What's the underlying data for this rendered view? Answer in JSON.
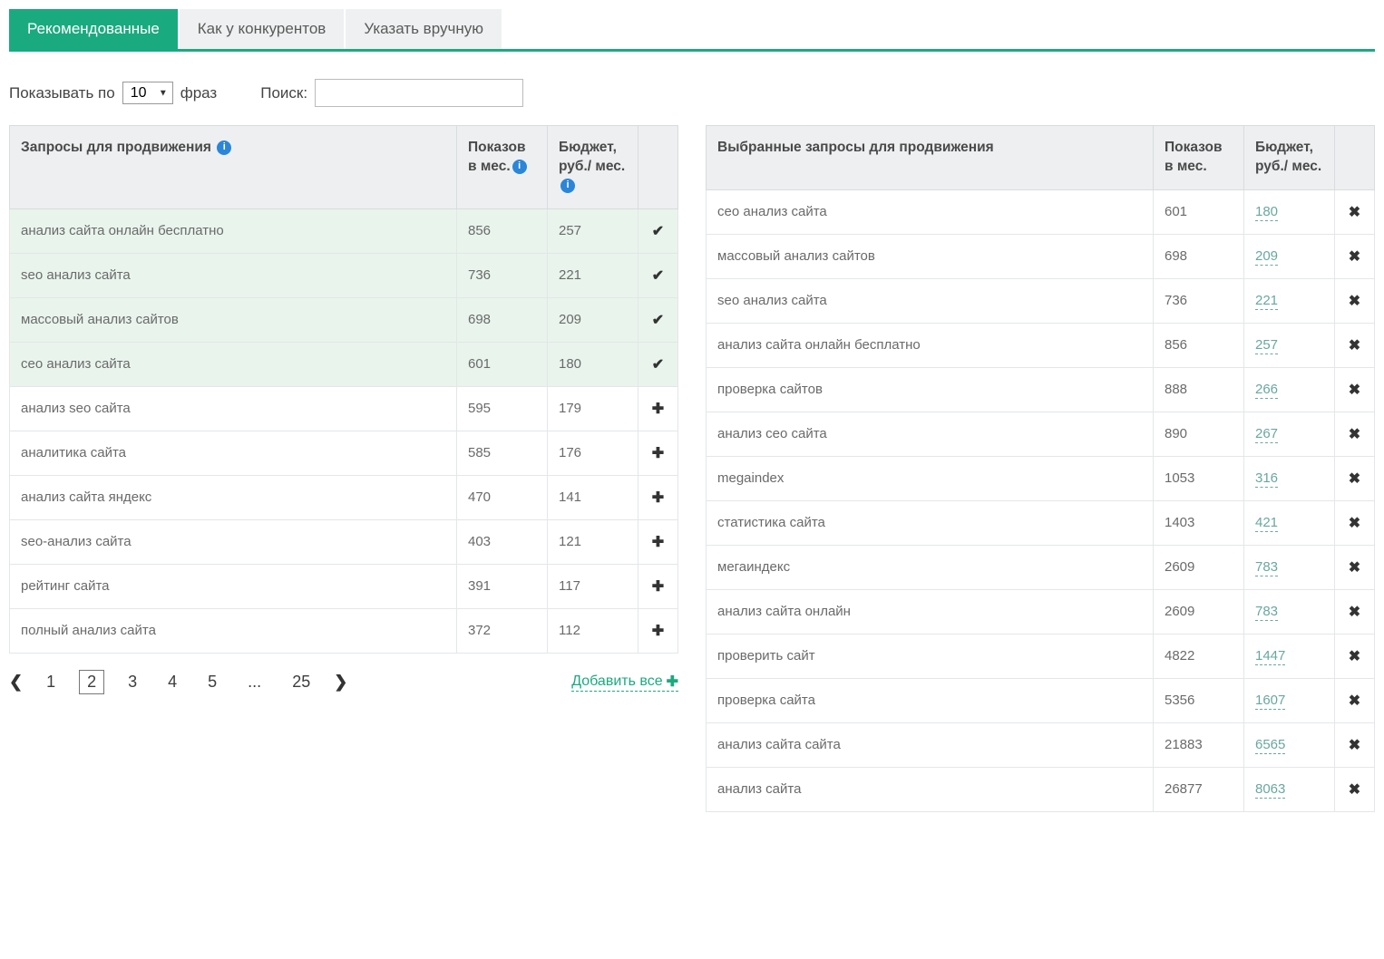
{
  "tabs": [
    {
      "label": "Рекомендованные",
      "active": true
    },
    {
      "label": "Как у конкурентов",
      "active": false
    },
    {
      "label": "Указать вручную",
      "active": false
    }
  ],
  "controls": {
    "show_prefix": "Показывать по",
    "per_page_value": "10",
    "show_suffix": "фраз",
    "search_label": "Поиск:"
  },
  "left_table": {
    "headers": {
      "query": "Запросы для продвижения",
      "views": "Показов в мес.",
      "budget": "Бюджет, руб./ мес."
    },
    "rows": [
      {
        "query": "анализ сайта онлайн бесплатно",
        "views": "856",
        "budget": "257",
        "selected": true
      },
      {
        "query": "seo анализ сайта",
        "views": "736",
        "budget": "221",
        "selected": true
      },
      {
        "query": "массовый анализ сайтов",
        "views": "698",
        "budget": "209",
        "selected": true
      },
      {
        "query": "сео анализ сайта",
        "views": "601",
        "budget": "180",
        "selected": true
      },
      {
        "query": "анализ seo сайта",
        "views": "595",
        "budget": "179",
        "selected": false
      },
      {
        "query": "аналитика сайта",
        "views": "585",
        "budget": "176",
        "selected": false
      },
      {
        "query": "анализ сайта яндекс",
        "views": "470",
        "budget": "141",
        "selected": false
      },
      {
        "query": "seo-анализ сайта",
        "views": "403",
        "budget": "121",
        "selected": false
      },
      {
        "query": "рейтинг сайта",
        "views": "391",
        "budget": "117",
        "selected": false
      },
      {
        "query": "полный анализ сайта",
        "views": "372",
        "budget": "112",
        "selected": false
      }
    ]
  },
  "right_table": {
    "headers": {
      "query": "Выбранные запросы для продвижения",
      "views": "Показов в мес.",
      "budget": "Бюджет, руб./ мес."
    },
    "rows": [
      {
        "query": "сео анализ сайта",
        "views": "601",
        "budget": "180"
      },
      {
        "query": "массовый анализ сайтов",
        "views": "698",
        "budget": "209"
      },
      {
        "query": "seo анализ сайта",
        "views": "736",
        "budget": "221"
      },
      {
        "query": "анализ сайта онлайн бесплатно",
        "views": "856",
        "budget": "257"
      },
      {
        "query": "проверка сайтов",
        "views": "888",
        "budget": "266"
      },
      {
        "query": "анализ сео сайта",
        "views": "890",
        "budget": "267"
      },
      {
        "query": "megaindex",
        "views": "1053",
        "budget": "316"
      },
      {
        "query": "статистика сайта",
        "views": "1403",
        "budget": "421"
      },
      {
        "query": "мегаиндекс",
        "views": "2609",
        "budget": "783"
      },
      {
        "query": "анализ сайта онлайн",
        "views": "2609",
        "budget": "783"
      },
      {
        "query": "проверить сайт",
        "views": "4822",
        "budget": "1447"
      },
      {
        "query": "проверка сайта",
        "views": "5356",
        "budget": "1607"
      },
      {
        "query": "анализ сайта сайта",
        "views": "21883",
        "budget": "6565"
      },
      {
        "query": "анализ сайта",
        "views": "26877",
        "budget": "8063"
      }
    ]
  },
  "pager": {
    "pages": [
      "1",
      "2",
      "3",
      "4",
      "5",
      "...",
      "25"
    ],
    "current": "2"
  },
  "add_all_label": "Добавить все",
  "info_char": "i"
}
